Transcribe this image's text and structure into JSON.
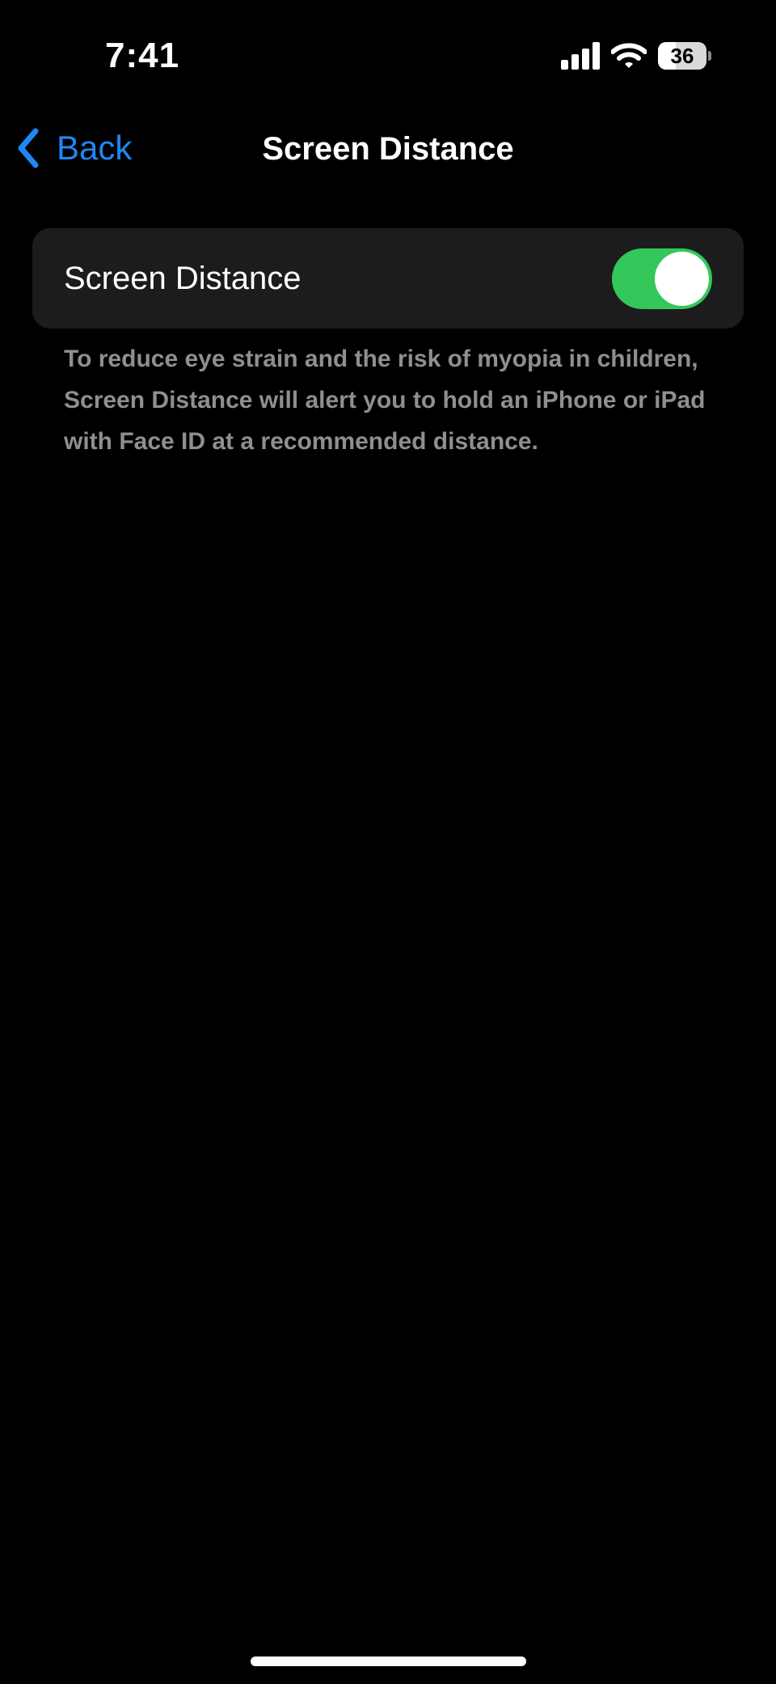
{
  "status_bar": {
    "time": "7:41",
    "battery_level": "36",
    "battery_fraction": 0.36,
    "icons": [
      "signal-icon",
      "wifi-icon",
      "battery-icon"
    ]
  },
  "nav": {
    "back_label": "Back",
    "title": "Screen Distance",
    "back_icon": "chevron-left-icon"
  },
  "settings": {
    "row_label": "Screen Distance",
    "toggle_on": true,
    "footer": "To reduce eye strain and the risk of myopia in children, Screen Distance will alert you to hold an iPhone or iPad with Face ID at a recommended distance."
  },
  "colors": {
    "accent": "#1e88f5",
    "toggle_on": "#34c759",
    "background": "#000000",
    "group_background": "#1c1c1e",
    "secondary_text": "#8e8e93"
  }
}
